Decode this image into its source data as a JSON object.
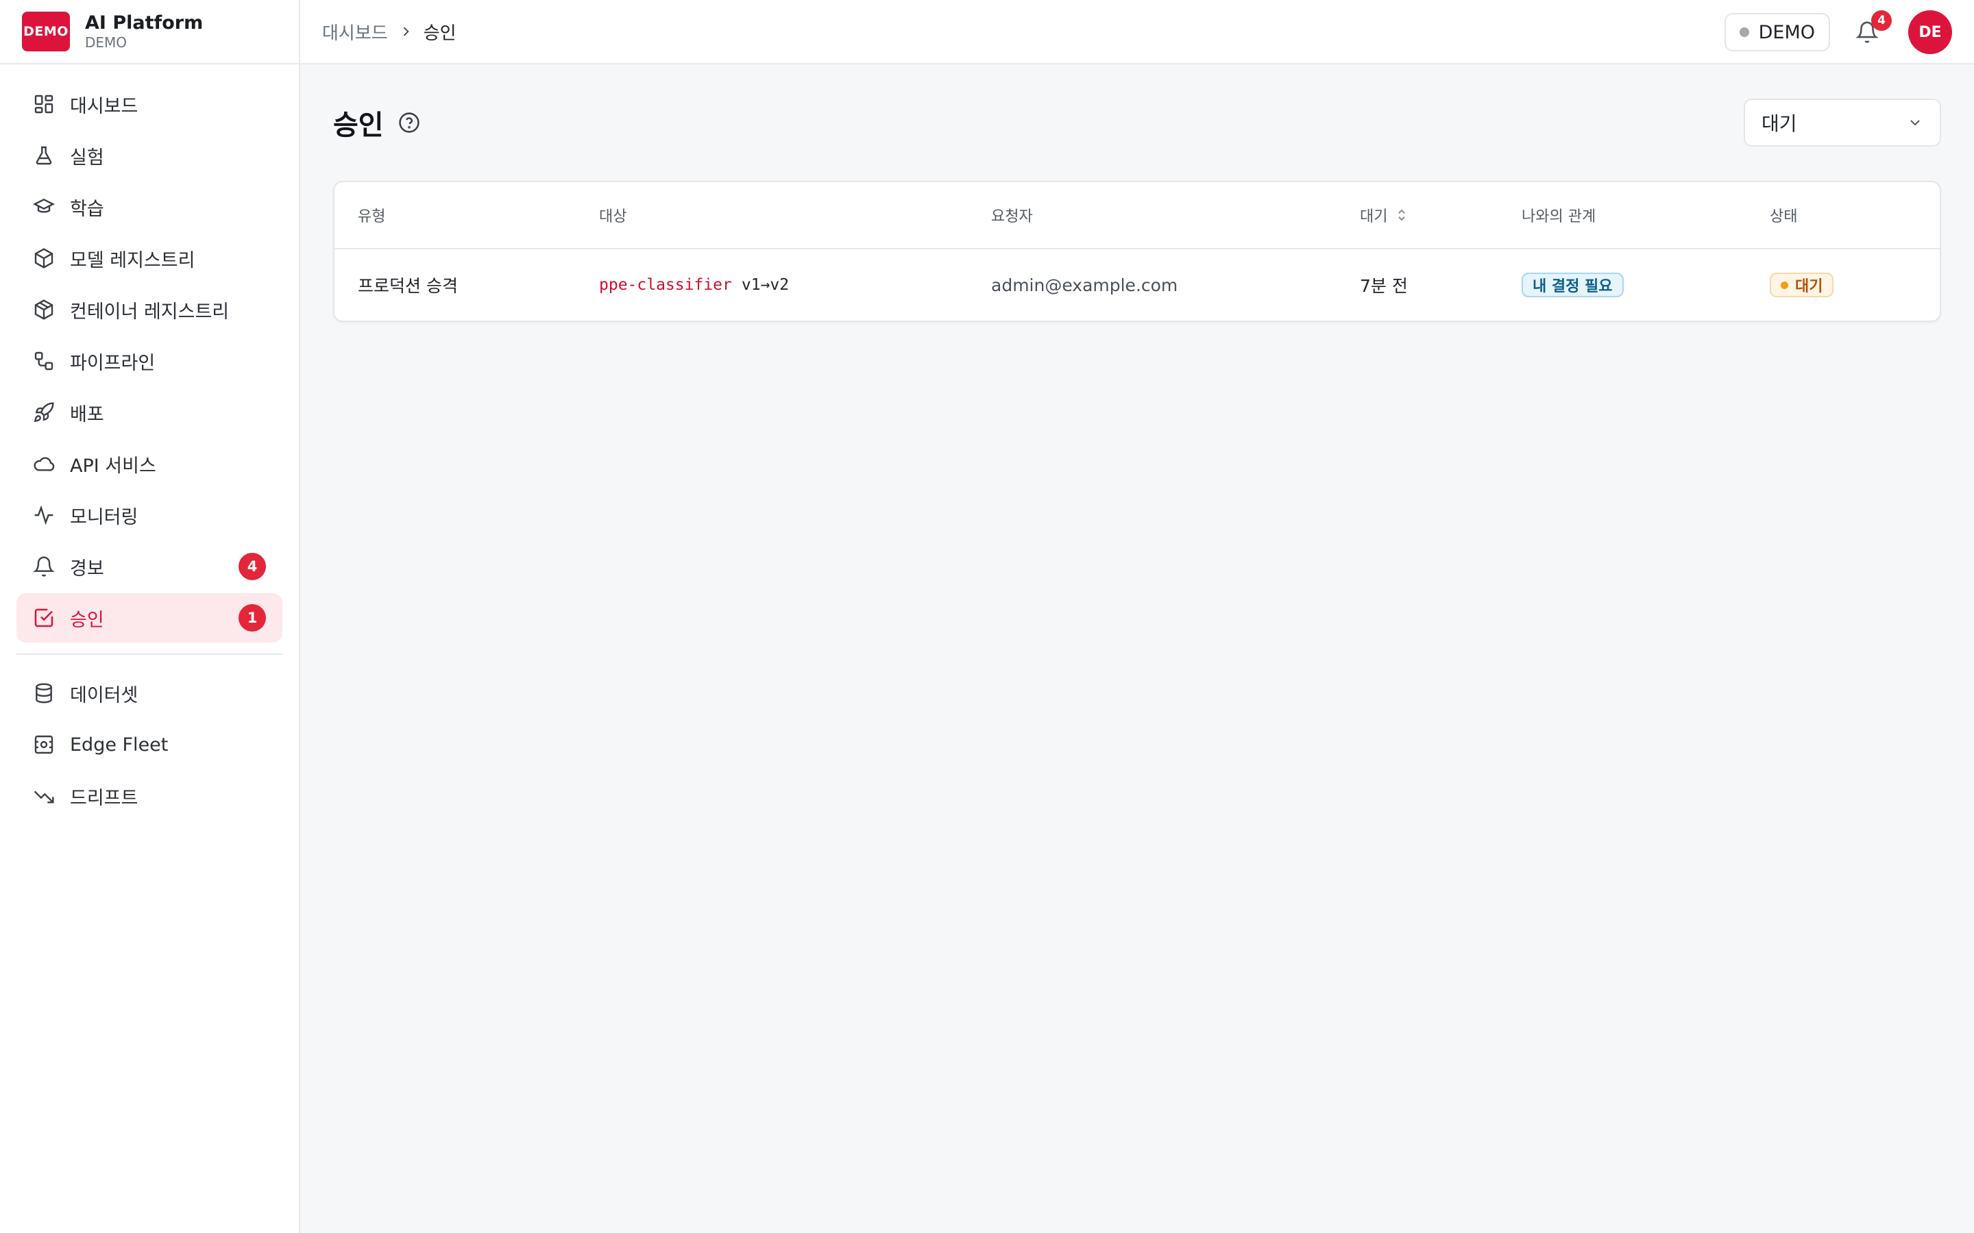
{
  "brand": {
    "logo_text": "DEMO",
    "name": "AI Platform",
    "sub": "DEMO",
    "color": "#dc143c"
  },
  "sidebar": {
    "items": [
      {
        "label": "대시보드",
        "icon": "grid-icon"
      },
      {
        "label": "실험",
        "icon": "flask-icon"
      },
      {
        "label": "학습",
        "icon": "graduation-cap-icon"
      },
      {
        "label": "모델 레지스트리",
        "icon": "cube-icon"
      },
      {
        "label": "컨테이너 레지스트리",
        "icon": "package-icon"
      },
      {
        "label": "파이프라인",
        "icon": "workflow-icon"
      },
      {
        "label": "배포",
        "icon": "rocket-icon"
      },
      {
        "label": "API 서비스",
        "icon": "cloud-icon"
      },
      {
        "label": "모니터링",
        "icon": "activity-icon"
      },
      {
        "label": "경보",
        "icon": "bell-icon",
        "badge": "4"
      },
      {
        "label": "승인",
        "icon": "check-square-icon",
        "badge": "1",
        "active": true
      }
    ],
    "secondary": [
      {
        "label": "데이터셋",
        "icon": "database-icon"
      },
      {
        "label": "Edge Fleet",
        "icon": "edge-device-icon"
      },
      {
        "label": "드리프트",
        "icon": "trending-down-icon"
      }
    ]
  },
  "topbar": {
    "breadcrumb": {
      "home": "대시보드",
      "current": "승인"
    },
    "env_label": "DEMO",
    "notification_count": "4",
    "avatar_initials": "DE"
  },
  "page": {
    "title": "승인",
    "filter": {
      "selected": "대기"
    }
  },
  "table": {
    "headers": {
      "type": "유형",
      "target": "대상",
      "requester": "요청자",
      "waiting": "대기",
      "relation": "나와의 관계",
      "status": "상태"
    },
    "rows": [
      {
        "type": "프로덕션 승격",
        "target_name": "ppe-classifier",
        "target_version": "v1→v2",
        "requester": "admin@example.com",
        "waiting": "7분 전",
        "relation": "내 결정 필요",
        "status": "대기"
      }
    ]
  }
}
